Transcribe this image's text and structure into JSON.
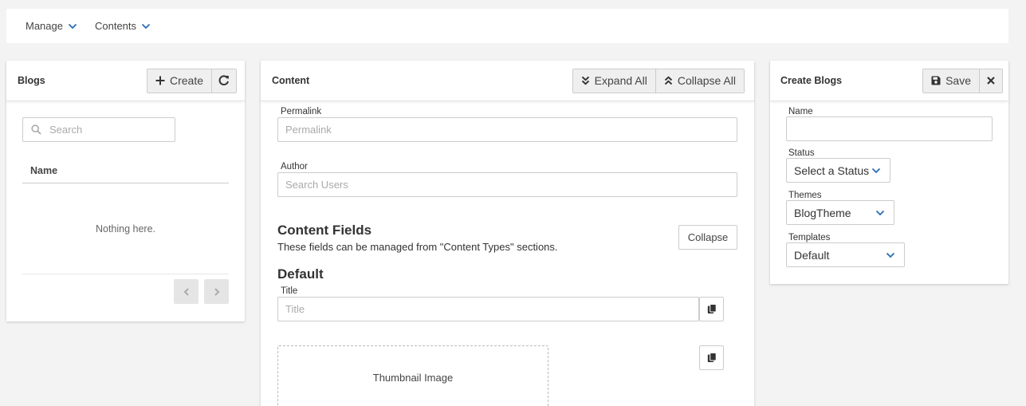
{
  "topnav": {
    "items": [
      {
        "label": "Manage"
      },
      {
        "label": "Contents"
      }
    ]
  },
  "blogs_panel": {
    "title": "Blogs",
    "create_label": "Create",
    "search_placeholder": "Search",
    "column_name": "Name",
    "empty_message": "Nothing here."
  },
  "content_panel": {
    "title": "Content",
    "expand_all_label": "Expand All",
    "collapse_all_label": "Collapse All",
    "permalink": {
      "label": "Permalink",
      "placeholder": "Permalink",
      "value": ""
    },
    "author": {
      "label": "Author",
      "placeholder": "Search Users",
      "value": ""
    },
    "content_fields": {
      "title": "Content Fields",
      "description": "These fields can be managed from \"Content Types\" sections.",
      "collapse_label": "Collapse"
    },
    "default_group": {
      "title": "Default",
      "title_field": {
        "label": "Title",
        "placeholder": "Title",
        "value": ""
      },
      "thumbnail_label": "Thumbnail Image"
    }
  },
  "create_panel": {
    "title": "Create Blogs",
    "save_label": "Save",
    "name": {
      "label": "Name",
      "value": ""
    },
    "status": {
      "label": "Status",
      "selected": "Select a Status"
    },
    "themes": {
      "label": "Themes",
      "selected": "BlogTheme"
    },
    "templates": {
      "label": "Templates",
      "selected": "Default"
    }
  },
  "colors": {
    "accent_chevron": "#2a6db5",
    "panel_bg": "#ffffff",
    "page_bg": "#f3f3f3"
  }
}
